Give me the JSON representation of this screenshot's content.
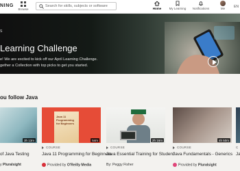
{
  "header": {
    "brand": "NING",
    "browse_label": "Browse",
    "search_placeholder": "Search for skills, subjects or software",
    "nav": [
      {
        "label": "Home",
        "icon": "home-icon",
        "active": true
      },
      {
        "label": "My Learning",
        "icon": "bookmark-icon",
        "active": false
      },
      {
        "label": "Notifications",
        "icon": "bell-icon",
        "active": false
      },
      {
        "label": "Me",
        "icon": "avatar",
        "active": false
      }
    ],
    "lang": "EN"
  },
  "hero": {
    "tag": "S",
    "title": "Learning Challenge",
    "description_line1": "e! We are excited to kick off our April Learning Challenge.",
    "description_line2": "gether a Collection with top picks to get you started."
  },
  "section": {
    "title": "ou follow Java"
  },
  "cards": [
    {
      "type_label": "",
      "title": "of Java Testing",
      "provider_prefix": "y",
      "provider": "Pluralsight",
      "duration": "3h 13m"
    },
    {
      "type_label": "COURSE",
      "title": "Java 11 Programming for Beginners",
      "provider_prefix": "Provided by",
      "provider": "O'Reilly Media",
      "duration": "54m",
      "cover_text": "Java 11 Programming for Beginners"
    },
    {
      "type_label": "COURSE",
      "title": "Java Essential Training for Student",
      "provider_prefix": "By:",
      "provider": "Peggy Fisher",
      "duration": "2h 16m"
    },
    {
      "type_label": "COURSE",
      "title": "Java Fundamentals - Generics",
      "provider_prefix": "Provided by",
      "provider": "Pluralsight",
      "duration": "4h 50m"
    },
    {
      "type_label": "C",
      "title": "Ja",
      "provider_prefix": "",
      "provider": "",
      "duration": ""
    }
  ]
}
